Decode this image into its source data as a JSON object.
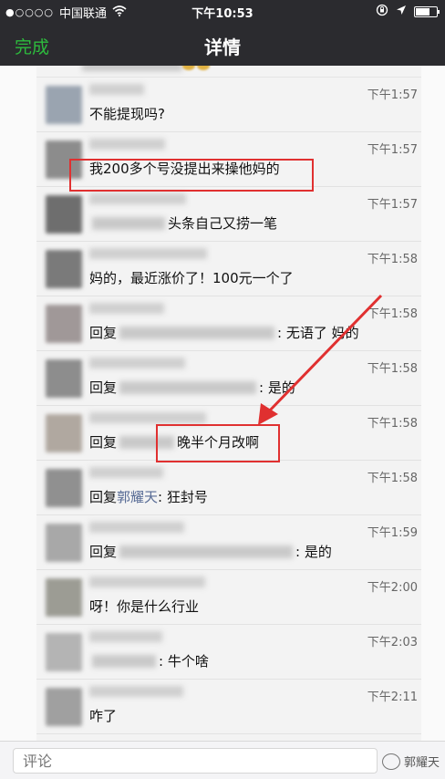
{
  "status_bar": {
    "signal_dots": "●○○○○",
    "carrier": "中国联通",
    "wifi_icon": "wifi-icon",
    "time": "下午10:53",
    "icons": [
      "rotation-lock-icon",
      "location-icon",
      "battery-icon"
    ],
    "battery_level": 0.7
  },
  "nav": {
    "done_label": "完成",
    "title": "详情"
  },
  "comments": [
    {
      "time": "下午1:57",
      "parts": [
        {
          "t": "text",
          "v": "不能提现吗?"
        }
      ]
    },
    {
      "time": "下午1:57",
      "parts": [
        {
          "t": "text",
          "v": "我200多个号没提出来操他妈的"
        }
      ]
    },
    {
      "time": "下午1:57",
      "parts": [
        {
          "t": "blur",
          "w": 80
        },
        {
          "t": "text",
          "v": "头条自己又捞一笔"
        }
      ]
    },
    {
      "time": "下午1:58",
      "parts": [
        {
          "t": "text",
          "v": "妈的，最近涨价了！100元一个了"
        }
      ]
    },
    {
      "time": "下午1:58",
      "parts": [
        {
          "t": "text",
          "v": "回复"
        },
        {
          "t": "blur",
          "w": 170
        },
        {
          "t": "text",
          "v": ": 无语了 妈的"
        }
      ]
    },
    {
      "time": "下午1:58",
      "parts": [
        {
          "t": "text",
          "v": "回复"
        },
        {
          "t": "blur",
          "w": 150
        },
        {
          "t": "text",
          "v": ": 是的"
        }
      ]
    },
    {
      "time": "下午1:58",
      "parts": [
        {
          "t": "text",
          "v": "回复"
        },
        {
          "t": "blur",
          "w": 60
        },
        {
          "t": "text",
          "v": "晚半个月改啊"
        }
      ]
    },
    {
      "time": "下午1:58",
      "parts": [
        {
          "t": "text",
          "v": "回复"
        },
        {
          "t": "name",
          "v": "郭耀天"
        },
        {
          "t": "text",
          "v": ": 狂封号"
        }
      ]
    },
    {
      "time": "下午1:59",
      "parts": [
        {
          "t": "text",
          "v": "回复"
        },
        {
          "t": "blur",
          "w": 190
        },
        {
          "t": "text",
          "v": ": 是的"
        }
      ]
    },
    {
      "time": "下午2:00",
      "parts": [
        {
          "t": "text",
          "v": "呀！你是什么行业"
        }
      ]
    },
    {
      "time": "下午2:03",
      "parts": [
        {
          "t": "blur",
          "w": 70
        },
        {
          "t": "text",
          "v": ": 牛个啥"
        }
      ]
    },
    {
      "time": "下午2:11",
      "parts": [
        {
          "t": "text",
          "v": "咋了"
        }
      ]
    }
  ],
  "input": {
    "placeholder": "评论"
  },
  "watermark": {
    "text": "郭耀天",
    "logo_icon": "wechat-account-logo-icon"
  },
  "annotation": {
    "highlight_color": "#e03030"
  }
}
